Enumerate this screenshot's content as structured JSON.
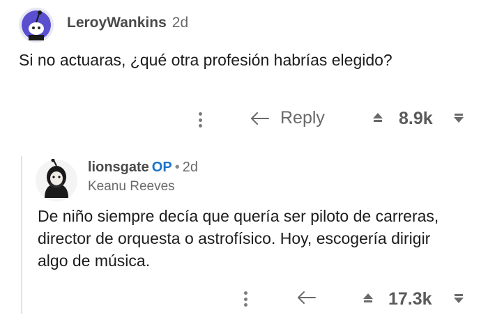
{
  "comment": {
    "username": "LeroyWankins",
    "age": "2d",
    "body": "Si no actuaras, ¿qué otra profesión habrías elegido?",
    "reply_label": "Reply",
    "score": "8.9k"
  },
  "reply": {
    "username": "lionsgate",
    "op_badge": "OP",
    "separator": "•",
    "age": "2d",
    "flair": "Keanu Reeves",
    "body": "De niño siempre decía que quería ser piloto de carreras, director de orquesta o astrofísico. Hoy, escogería dirigir algo de música.",
    "score": "17.3k"
  },
  "colors": {
    "op_badge": "#1d74c8",
    "avatar1_bg": "#5a4fcf",
    "thread_line": "#e3e3e3"
  }
}
